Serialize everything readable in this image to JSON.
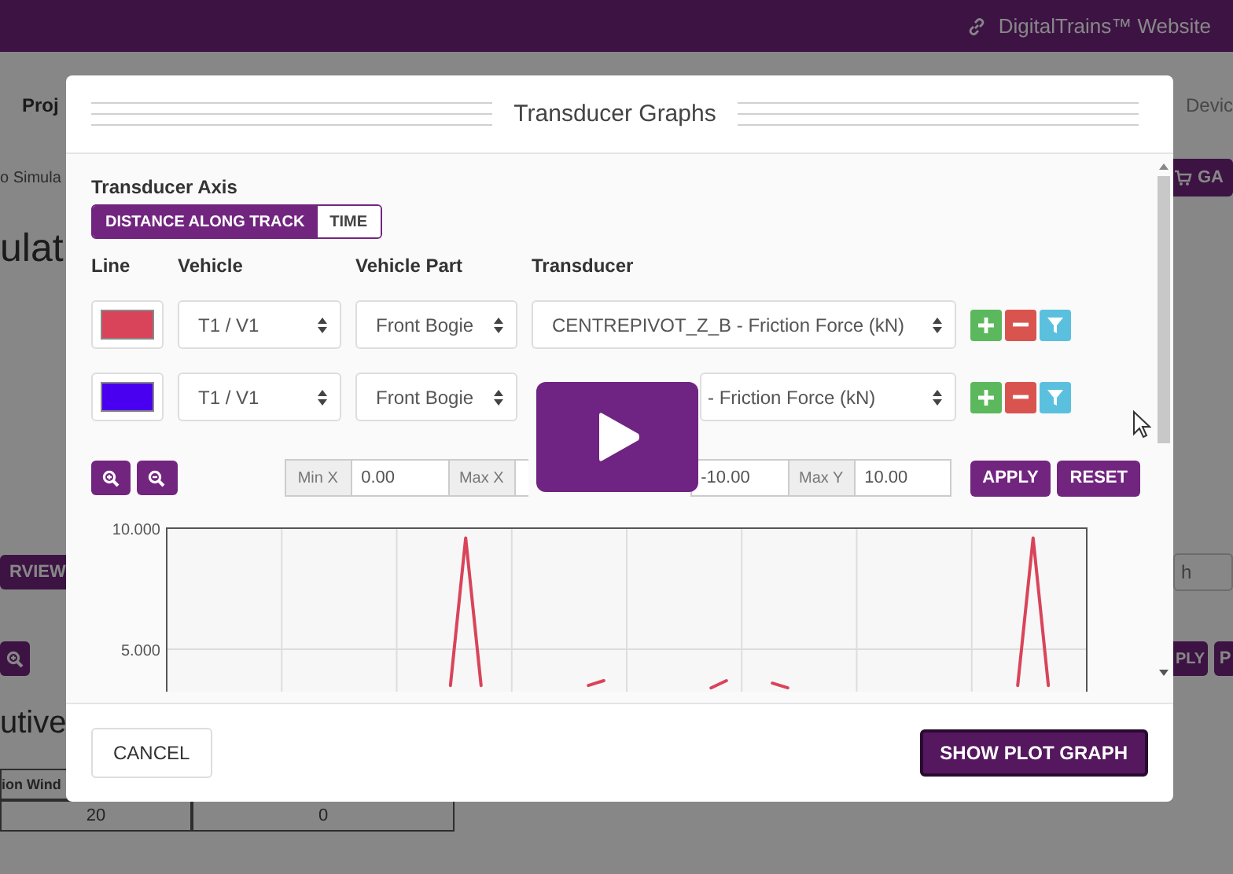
{
  "top_bar": {
    "link": "DigitalTrains™ Website"
  },
  "background": {
    "nav": [
      "Proj",
      "Devic"
    ],
    "breadcrumb": "o Simula",
    "side_button": "GA",
    "heading": "ulat",
    "overview_button": "RVIEW",
    "search_field": {
      "placeholder": "h"
    },
    "apply_button": "PLY",
    "next_button": "P",
    "section_heading": "utive",
    "table": {
      "header": "ion Wind",
      "rows": [
        [
          "20",
          "0"
        ]
      ]
    }
  },
  "modal": {
    "title": "Transducer Graphs",
    "axis": {
      "label": "Transducer Axis",
      "options": [
        {
          "label": "DISTANCE ALONG TRACK",
          "selected": true
        },
        {
          "label": "TIME",
          "selected": false
        }
      ]
    },
    "columns": [
      "Line",
      "Vehicle",
      "Vehicle Part",
      "Transducer"
    ],
    "lines": [
      {
        "color": "#d9445a",
        "vehicle": "T1 / V1",
        "part": "Front Bogie",
        "transducer": "CENTREPIVOT_Z_B - Friction Force (kN)"
      },
      {
        "color": "#4a00f0",
        "vehicle": "T1 / V1",
        "part": "Front Bogie",
        "transducer": "- Friction Force (kN)"
      }
    ],
    "range": [
      {
        "label": "Min X",
        "value": "0.00"
      },
      {
        "label": "Max X"
      },
      {
        "value": "-10.00"
      },
      {
        "label": "Max Y",
        "value": "10.00"
      }
    ],
    "range_buttons": [
      "APPLY",
      "RESET"
    ],
    "chart_data": {
      "type": "line",
      "grid": true,
      "ylim": [
        3.3,
        10
      ],
      "yticks": [
        {
          "value": 5,
          "label": "5.000"
        },
        {
          "value": 10,
          "label": "10.000"
        }
      ],
      "series": [
        {
          "color": "#d9445a",
          "values": [
            null,
            null,
            null,
            null,
            null,
            null,
            null,
            null,
            null,
            null,
            null,
            null,
            null,
            null,
            null,
            null,
            null,
            null,
            3.5,
            9.6,
            3.5,
            null,
            null,
            null,
            null,
            null,
            null,
            3.5,
            3.7,
            null,
            null,
            null,
            null,
            null,
            null,
            3.4,
            3.7,
            null,
            null,
            3.6,
            3.4,
            null,
            null,
            null,
            null,
            null,
            null,
            null,
            null,
            null,
            null,
            null,
            null,
            null,
            null,
            3.5,
            9.6,
            3.5,
            null,
            null
          ]
        }
      ]
    },
    "footer": {
      "cancel": "CANCEL",
      "confirm": "SHOW PLOT GRAPH"
    }
  }
}
